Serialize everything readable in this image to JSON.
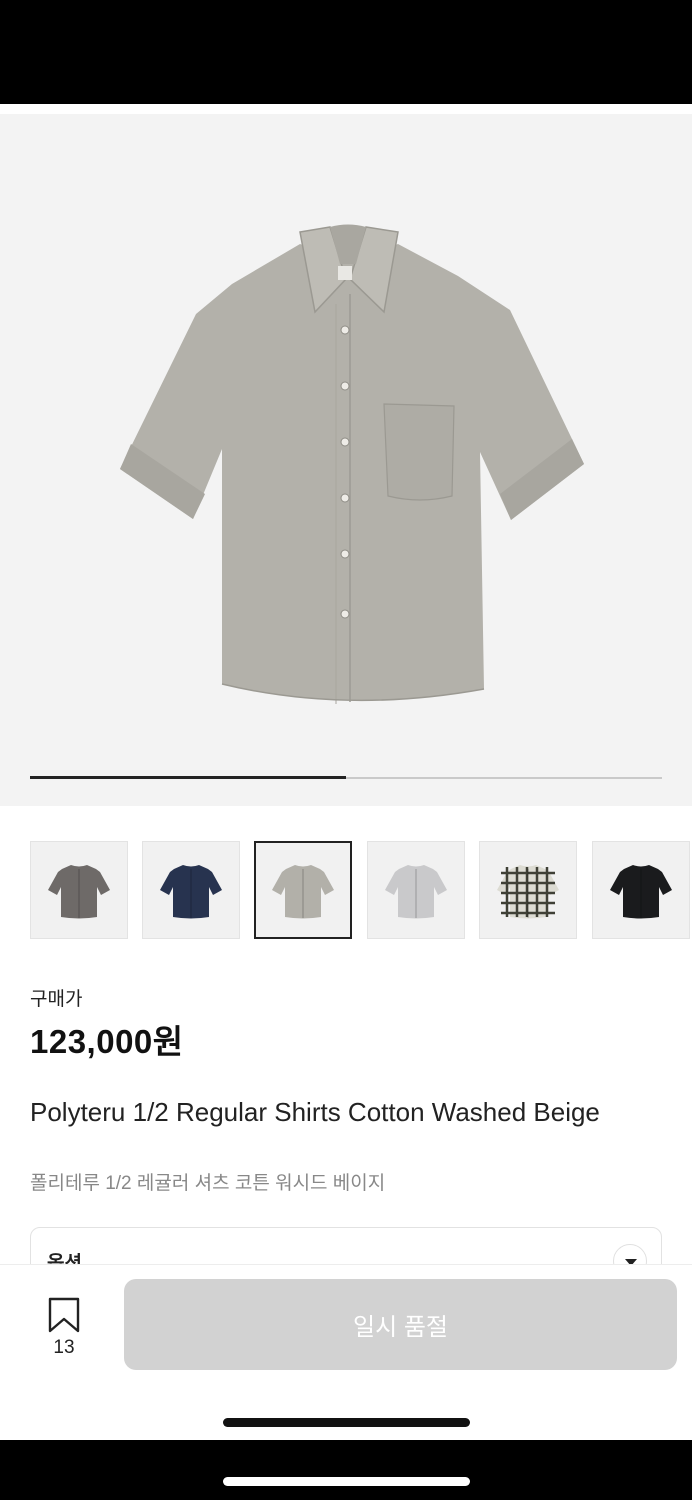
{
  "product": {
    "price_label": "구매가",
    "price": "123,000원",
    "title_en": "Polyteru 1/2 Regular Shirts Cotton Washed Beige",
    "title_ko": "폴리테루 1/2 레귤러 셔츠 코튼 워시드 베이지",
    "image_progress": 0.5
  },
  "colors": {
    "hero_shirt": "#b3b1aa",
    "accent": "#222222",
    "disabled_button": "#d2d2d2"
  },
  "variants": [
    {
      "name": "gray",
      "color": "#6e6a68",
      "selected": false
    },
    {
      "name": "navy",
      "color": "#27334f",
      "selected": false
    },
    {
      "name": "beige",
      "color": "#b2b0a9",
      "selected": true
    },
    {
      "name": "light-gray",
      "color": "#c9c9cb",
      "selected": false
    },
    {
      "name": "check",
      "color": "#d8d7cc",
      "selected": false
    },
    {
      "name": "black",
      "color": "#1a1b1d",
      "selected": false
    }
  ],
  "option": {
    "label": "옵션"
  },
  "bottom": {
    "wishlist_count": "13",
    "buy_button_label": "일시 품절",
    "wishlist_icon": "bookmark-icon"
  }
}
